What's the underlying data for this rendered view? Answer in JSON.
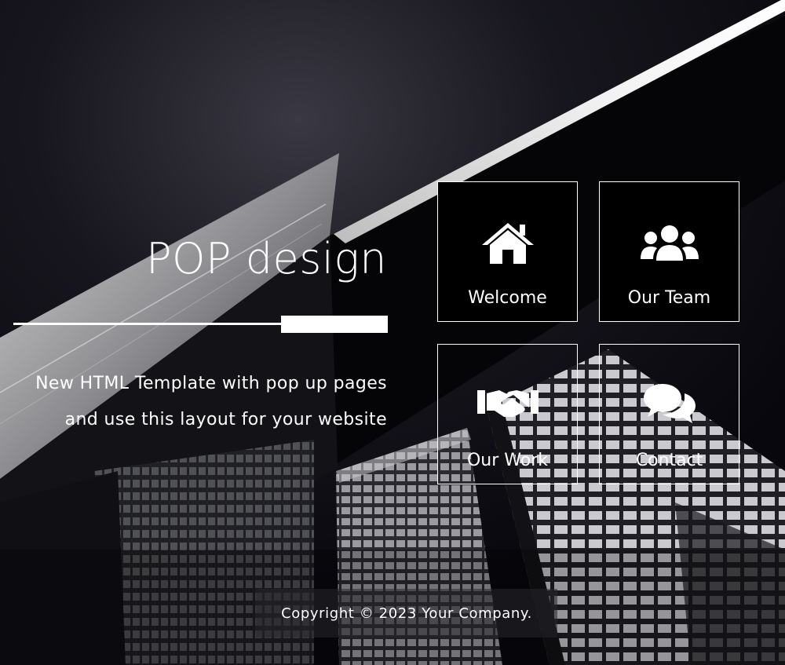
{
  "hero": {
    "title": "POP design",
    "tagline_line1": "New HTML Template with pop up pages",
    "tagline_line2": "and use this layout for your website"
  },
  "tiles": [
    {
      "label": "Welcome",
      "icon": "home-icon"
    },
    {
      "label": "Our Team",
      "icon": "users-icon"
    },
    {
      "label": "Our Work",
      "icon": "handshake-icon"
    },
    {
      "label": "Contact",
      "icon": "comments-icon"
    }
  ],
  "footer": {
    "copyright": "Copyright © 2023 Your Company."
  },
  "colors": {
    "text": "#ffffff",
    "tile_border": "#ffffff",
    "tile_fill": "#000000",
    "background": "#0b0a12"
  }
}
